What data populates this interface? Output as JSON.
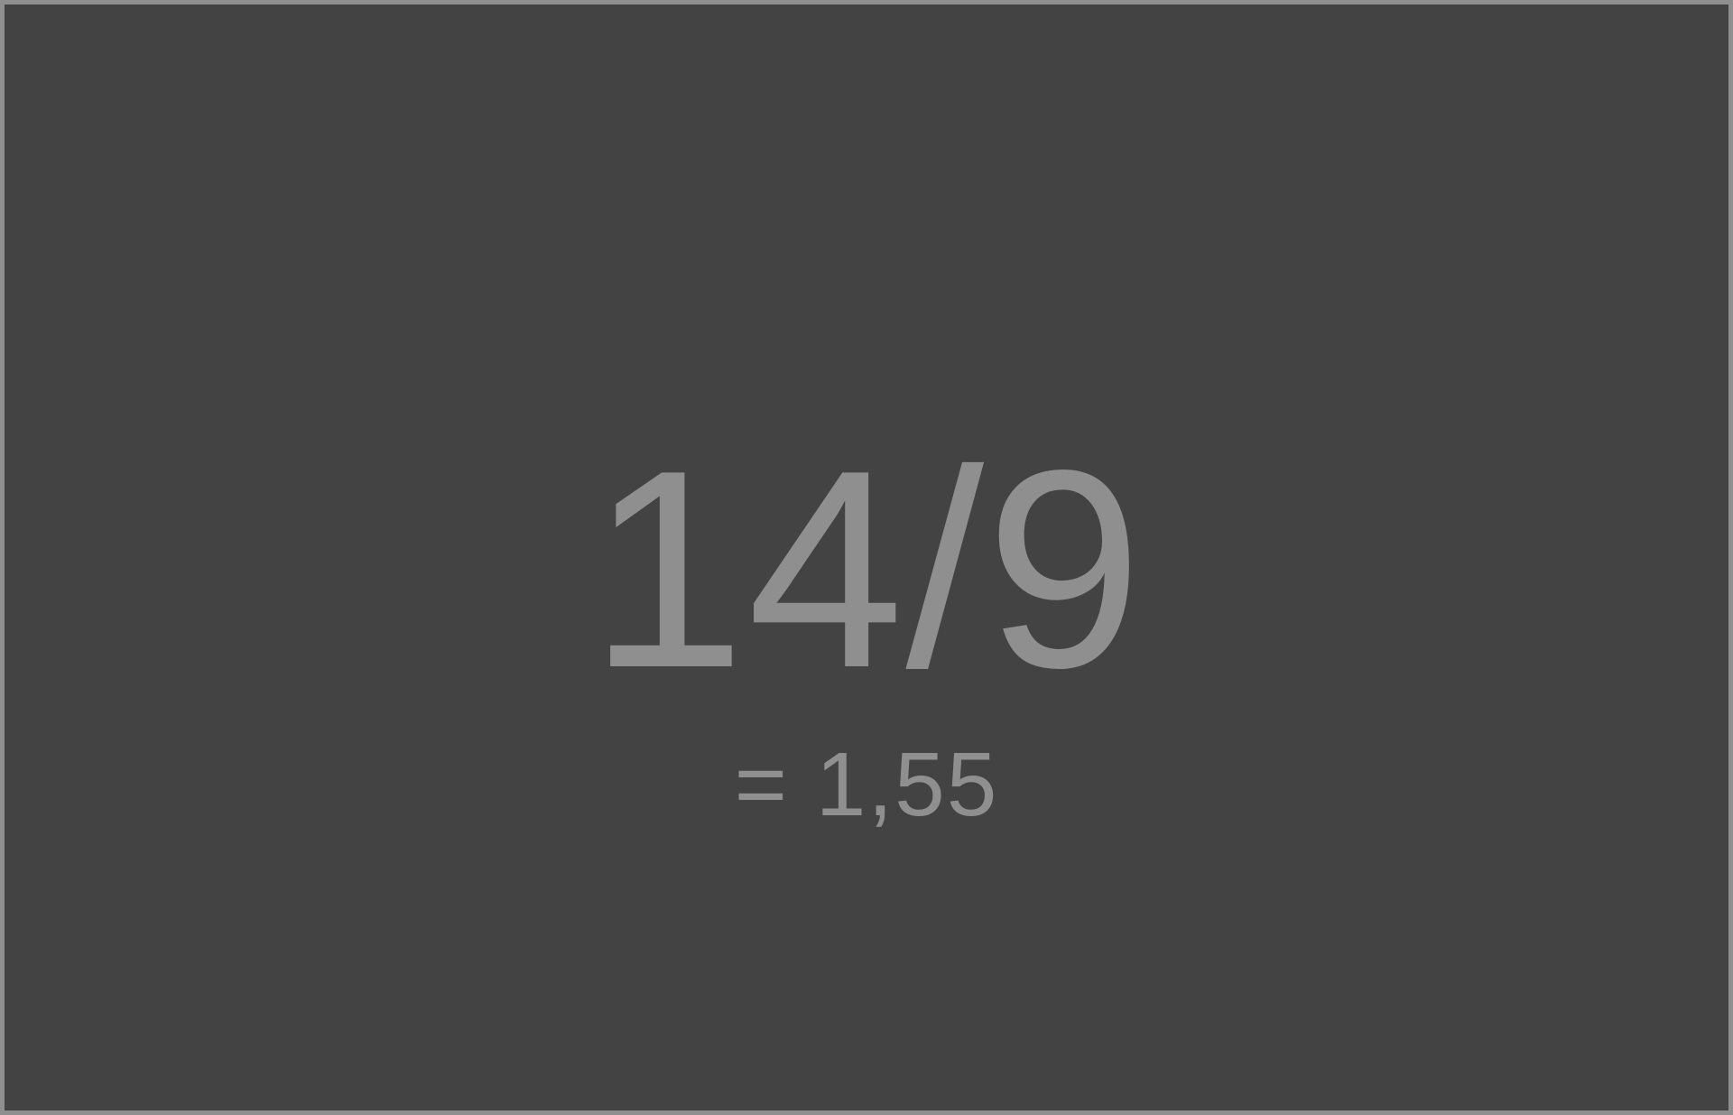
{
  "aspect_ratio": {
    "fraction_text": "14/9",
    "decimal_text": "= 1,55"
  },
  "colors": {
    "background": "#434343",
    "text": "#8f8f8f",
    "border": "#8f8f8f"
  }
}
